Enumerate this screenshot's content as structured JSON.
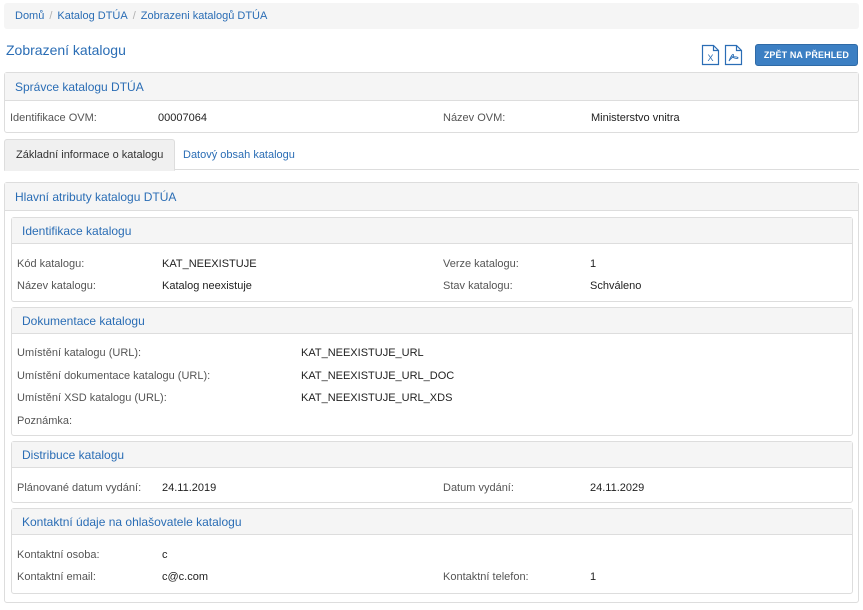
{
  "breadcrumb": [
    "Domů",
    "Katalog DTÚA",
    "Zobrazeni katalogů DTÚA"
  ],
  "page_title": "Zobrazení katalogu",
  "toolbar": {
    "excel_icon": "excel-file-icon",
    "pdf_icon": "pdf-file-icon",
    "back_label": "ZPĚT NA PŘEHLED"
  },
  "admin": {
    "heading": "Správce katalogu DTÚA",
    "ovm_id_label": "Identifikace OVM:",
    "ovm_id_value": "00007064",
    "ovm_name_label": "Název OVM:",
    "ovm_name_value": "Ministerstvo vnitra"
  },
  "tabs": [
    "Základní informace o katalogu",
    "Datový obsah katalogu"
  ],
  "main": {
    "heading": "Hlavní atributy katalogu DTÚA",
    "identification": {
      "heading": "Identifikace katalogu",
      "code_label": "Kód katalogu:",
      "code_value": "KAT_NEEXISTUJE",
      "version_label": "Verze katalogu:",
      "version_value": "1",
      "name_label": "Název katalogu:",
      "name_value": "Katalog neexistuje",
      "state_label": "Stav katalogu:",
      "state_value": "Schváleno"
    },
    "documentation": {
      "heading": "Dokumentace katalogu",
      "url_label": "Umístění katalogu (URL):",
      "url_value": "KAT_NEEXISTUJE_URL",
      "doc_label": "Umístění dokumentace katalogu (URL):",
      "doc_value": "KAT_NEEXISTUJE_URL_DOC",
      "xsd_label": "Umístění XSD katalogu (URL):",
      "xsd_value": "KAT_NEEXISTUJE_URL_XDS",
      "note_label": "Poznámka:"
    },
    "distribution": {
      "heading": "Distribuce katalogu",
      "planned_label": "Plánované datum vydání:",
      "planned_value": "24.11.2019",
      "release_label": "Datum vydání:",
      "release_value": "24.11.2029"
    },
    "contact": {
      "heading": "Kontaktní údaje na ohlašovatele katalogu",
      "person_label": "Kontaktní osoba:",
      "person_value": "c",
      "email_label": "Kontaktní email:",
      "email_value": "c@c.com",
      "phone_label": "Kontaktní telefon:",
      "phone_value": "1"
    }
  }
}
